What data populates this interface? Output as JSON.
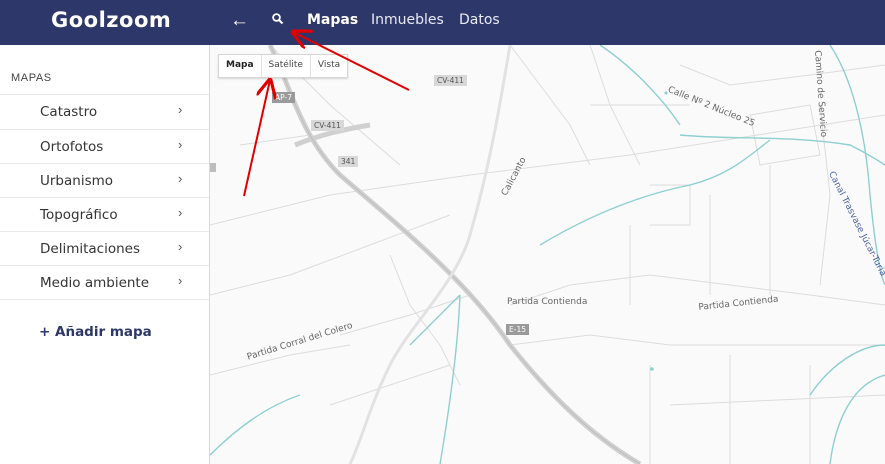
{
  "header": {
    "logo": "Goolzoom",
    "back_icon": "←",
    "search_icon": "search-icon",
    "nav": [
      "Mapas",
      "Inmuebles",
      "Datos"
    ]
  },
  "sidebar": {
    "title": "MAPAS",
    "items": [
      {
        "label": "Catastro"
      },
      {
        "label": "Ortofotos"
      },
      {
        "label": "Urbanismo"
      },
      {
        "label": "Topográfico"
      },
      {
        "label": "Delimitaciones"
      },
      {
        "label": "Medio ambiente"
      }
    ],
    "add_map": "+ Añadir mapa"
  },
  "map": {
    "tabs": [
      "Mapa",
      "Satélite",
      "Vista"
    ],
    "active_tab": "Mapa",
    "road_labels": [
      "AP-7",
      "CV-411",
      "CV-411",
      "341",
      "E-15"
    ],
    "place_labels": [
      "Calle Nº 2 Núcleo 25",
      "Camino de Servicio",
      "Calicanto",
      "Canal Trasvase Júcar-Turia",
      "Partida Contienda",
      "Partida Contienda",
      "Partida Corral del Colero"
    ]
  },
  "colors": {
    "header_bg": "#2e3769",
    "accent": "#2e3769",
    "water": "#8fcfcf",
    "arrow": "#e00000"
  }
}
